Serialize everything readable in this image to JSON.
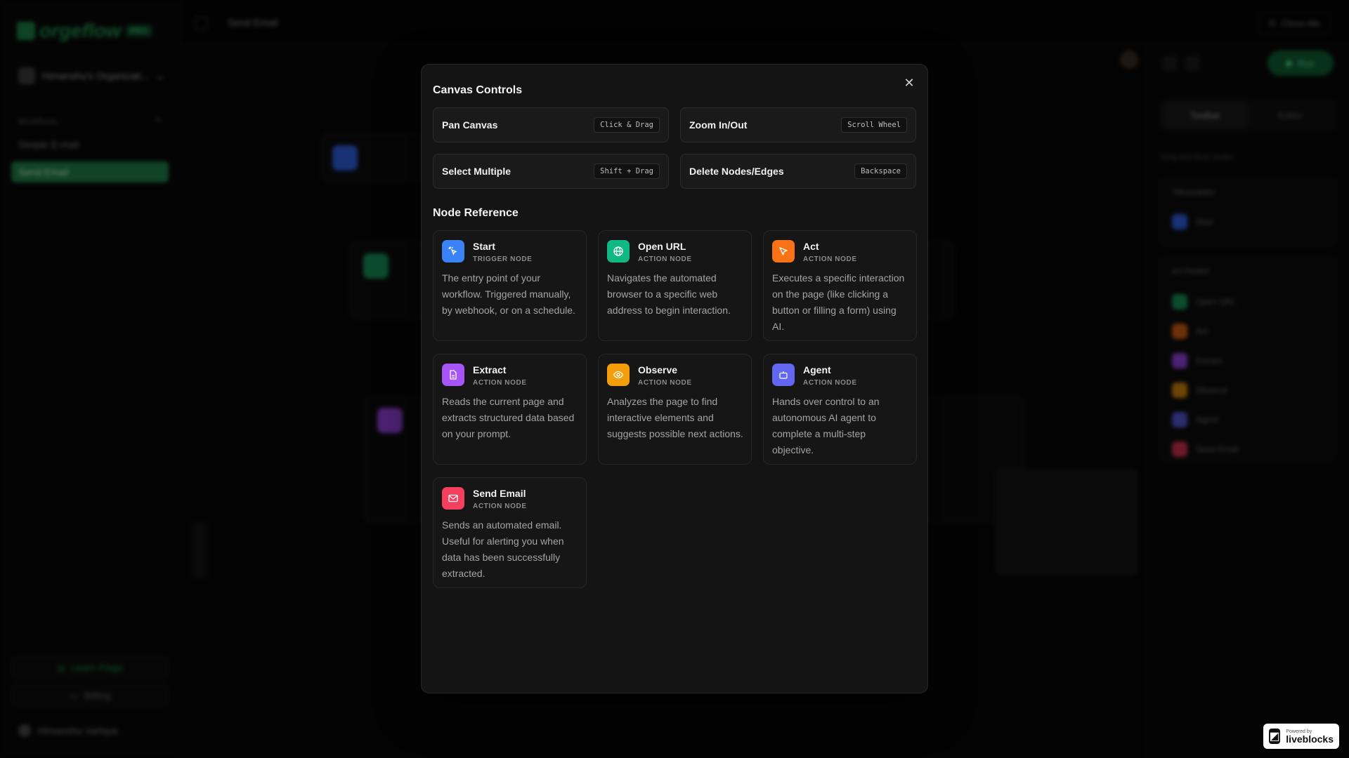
{
  "app": {
    "brand": "orgeflow",
    "plan": "PRO",
    "organization": "Himanshu's Organizati...",
    "workflows_label": "Workflows",
    "workflows": [
      "Simple E-mail"
    ],
    "active_workflow": "Send Email",
    "learn_label": "Learn Flags",
    "billing_label": "Billing",
    "user_name": "Himanshu Varlaya",
    "workflow_title": "Send Email",
    "clone_label": "Clone Me",
    "run_label": "Run",
    "tabs": [
      "Toolbar",
      "Editor"
    ],
    "toolbox_hint": "Drag and drop nodes",
    "triggers_label": "TRIGGERS",
    "trigger_items": [
      "Start"
    ],
    "actions_label": "ACTIONS",
    "action_items": [
      "Open URL",
      "Act",
      "Extract",
      "Observe",
      "Agent",
      "Send Email"
    ]
  },
  "modal": {
    "canvas_title": "Canvas Controls",
    "controls": [
      {
        "label": "Pan Canvas",
        "key": "Click & Drag"
      },
      {
        "label": "Zoom In/Out",
        "key": "Scroll Wheel"
      },
      {
        "label": "Select Multiple",
        "key": "Shift + Drag"
      },
      {
        "label": "Delete Nodes/Edges",
        "key": "Backspace"
      }
    ],
    "node_title": "Node Reference",
    "nodes": [
      {
        "name": "Start",
        "type": "TRIGGER NODE",
        "color": "#3b82f6",
        "icon": "pointer-click-icon",
        "desc": "The entry point of your workflow. Triggered manually, by webhook, or on a schedule."
      },
      {
        "name": "Open URL",
        "type": "ACTION NODE",
        "color": "#10b981",
        "icon": "globe-icon",
        "desc": "Navigates the automated browser to a specific web address to begin interaction."
      },
      {
        "name": "Act",
        "type": "ACTION NODE",
        "color": "#f97316",
        "icon": "cursor-icon",
        "desc": "Executes a specific interaction on the page (like clicking a button or filling a form) using AI."
      },
      {
        "name": "Extract",
        "type": "ACTION NODE",
        "color": "#a855f7",
        "icon": "document-icon",
        "desc": "Reads the current page and extracts structured data based on your prompt."
      },
      {
        "name": "Observe",
        "type": "ACTION NODE",
        "color": "#f59e0b",
        "icon": "eye-icon",
        "desc": "Analyzes the page to find interactive elements and suggests possible next actions."
      },
      {
        "name": "Agent",
        "type": "ACTION NODE",
        "color": "#6366f1",
        "icon": "robot-icon",
        "desc": "Hands over control to an autonomous AI agent to complete a multi-step objective."
      },
      {
        "name": "Send Email",
        "type": "ACTION NODE",
        "color": "#f43f5e",
        "icon": "mail-icon",
        "desc": "Sends an automated email. Useful for alerting you when data has been successfully extracted."
      }
    ]
  },
  "badge": {
    "small": "Powered by",
    "brand": "liveblocks"
  }
}
